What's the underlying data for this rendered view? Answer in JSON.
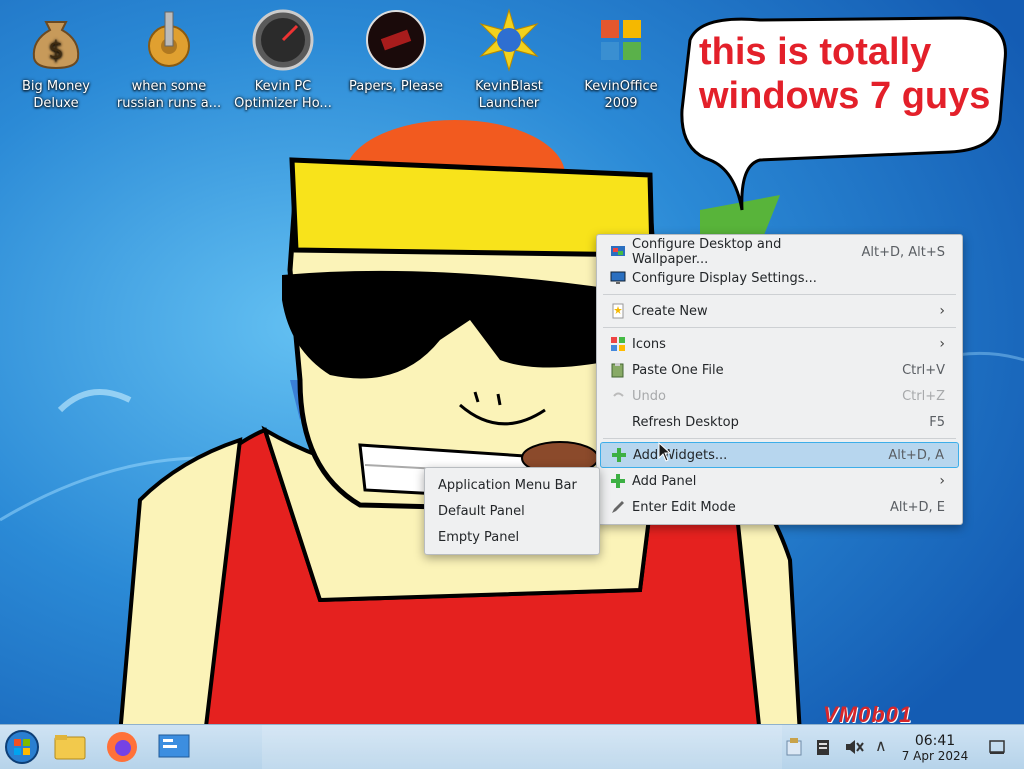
{
  "desktop_icons": [
    {
      "label": "Big Money\nDeluxe",
      "icon": "money-bag-icon"
    },
    {
      "label": "when some\nrussian runs a...",
      "icon": "gear-icon"
    },
    {
      "label": "Kevin PC\nOptimizer Ho...",
      "icon": "gauge-icon"
    },
    {
      "label": "Papers, Please",
      "icon": "papers-please-icon"
    },
    {
      "label": "KevinBlast\nLauncher",
      "icon": "starburst-icon"
    },
    {
      "label": "KevinOffice\n2009",
      "icon": "office-icon"
    }
  ],
  "speech_bubble": {
    "text": "this is totally windows 7 guys"
  },
  "watermark": "VM0b01",
  "context_menu": {
    "items": [
      {
        "label": "Configure Desktop and Wallpaper...",
        "shortcut": "Alt+D, Alt+S",
        "icon": "desktop-config-icon"
      },
      {
        "label": "Configure Display Settings...",
        "shortcut": "",
        "icon": "display-icon"
      },
      {
        "label": "Create New",
        "shortcut": "",
        "icon": "new-document-icon",
        "submenu": true
      },
      {
        "label": "Icons",
        "shortcut": "",
        "icon": "icons-icon",
        "submenu": true
      },
      {
        "label": "Paste One File",
        "shortcut": "Ctrl+V",
        "icon": "paste-icon"
      },
      {
        "label": "Undo",
        "shortcut": "Ctrl+Z",
        "icon": "undo-icon",
        "disabled": true
      },
      {
        "label": "Refresh Desktop",
        "shortcut": "F5",
        "icon": "refresh-icon"
      },
      {
        "label": "Add Widgets...",
        "shortcut": "Alt+D, A",
        "icon": "plus-icon",
        "highlighted": true
      },
      {
        "label": "Add Panel",
        "shortcut": "",
        "icon": "plus-icon",
        "submenu": true
      },
      {
        "label": "Enter Edit Mode",
        "shortcut": "Alt+D, E",
        "icon": "edit-icon"
      }
    ]
  },
  "add_panel_submenu": {
    "items": [
      "Application Menu Bar",
      "Default Panel",
      "Empty Panel"
    ]
  },
  "taskbar": {
    "start_icon": "windows-orb-icon",
    "pinned": [
      "file-manager-icon",
      "firefox-icon",
      "control-panel-icon"
    ],
    "clock": {
      "time": "06:41",
      "date": "7 Apr 2024"
    }
  },
  "colors": {
    "menu_highlight": "#b7d6ee",
    "menu_highlight_border": "#3daee9",
    "bubble_text": "#e3202a"
  }
}
